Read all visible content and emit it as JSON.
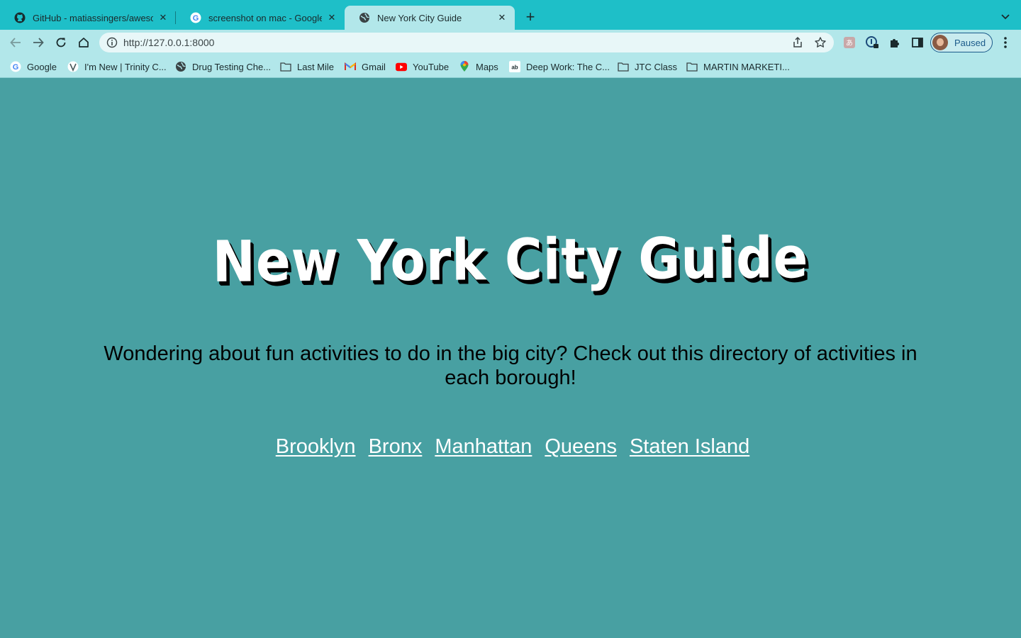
{
  "browser": {
    "tabs": [
      {
        "title": "GitHub - matiassingers/awesome",
        "icon": "github-icon"
      },
      {
        "title": "screenshot on mac - Google Search",
        "icon": "google-icon"
      },
      {
        "title": "New York City Guide",
        "icon": "globe-icon",
        "active": true
      }
    ],
    "new_tab_label": "+",
    "close_glyph": "✕",
    "url": "http://127.0.0.1:8000",
    "profile_label": "Paused",
    "bookmarks": [
      {
        "label": "Google",
        "icon": "google-icon"
      },
      {
        "label": "I'm New | Trinity C...",
        "icon": "trinity-icon"
      },
      {
        "label": "Drug Testing Che...",
        "icon": "globe-icon"
      },
      {
        "label": "Last Mile",
        "icon": "folder-icon"
      },
      {
        "label": "Gmail",
        "icon": "gmail-icon"
      },
      {
        "label": "YouTube",
        "icon": "youtube-icon"
      },
      {
        "label": "Maps",
        "icon": "maps-icon"
      },
      {
        "label": "Deep Work: The C...",
        "icon": "ab-icon"
      },
      {
        "label": "JTC Class",
        "icon": "folder-icon"
      },
      {
        "label": "MARTIN MARKETI...",
        "icon": "folder-icon"
      }
    ],
    "colors": {
      "tabstrip": "#1ebfc8",
      "toolbar": "#b2e7ea",
      "page_bg": "#48a0a2"
    }
  },
  "page": {
    "title": "New York City Guide",
    "intro": "Wondering about fun activities to do in the big city? Check out this directory of activities in each borough!",
    "boroughs": [
      "Brooklyn",
      "Bronx",
      "Manhattan",
      "Queens",
      "Staten Island"
    ]
  }
}
